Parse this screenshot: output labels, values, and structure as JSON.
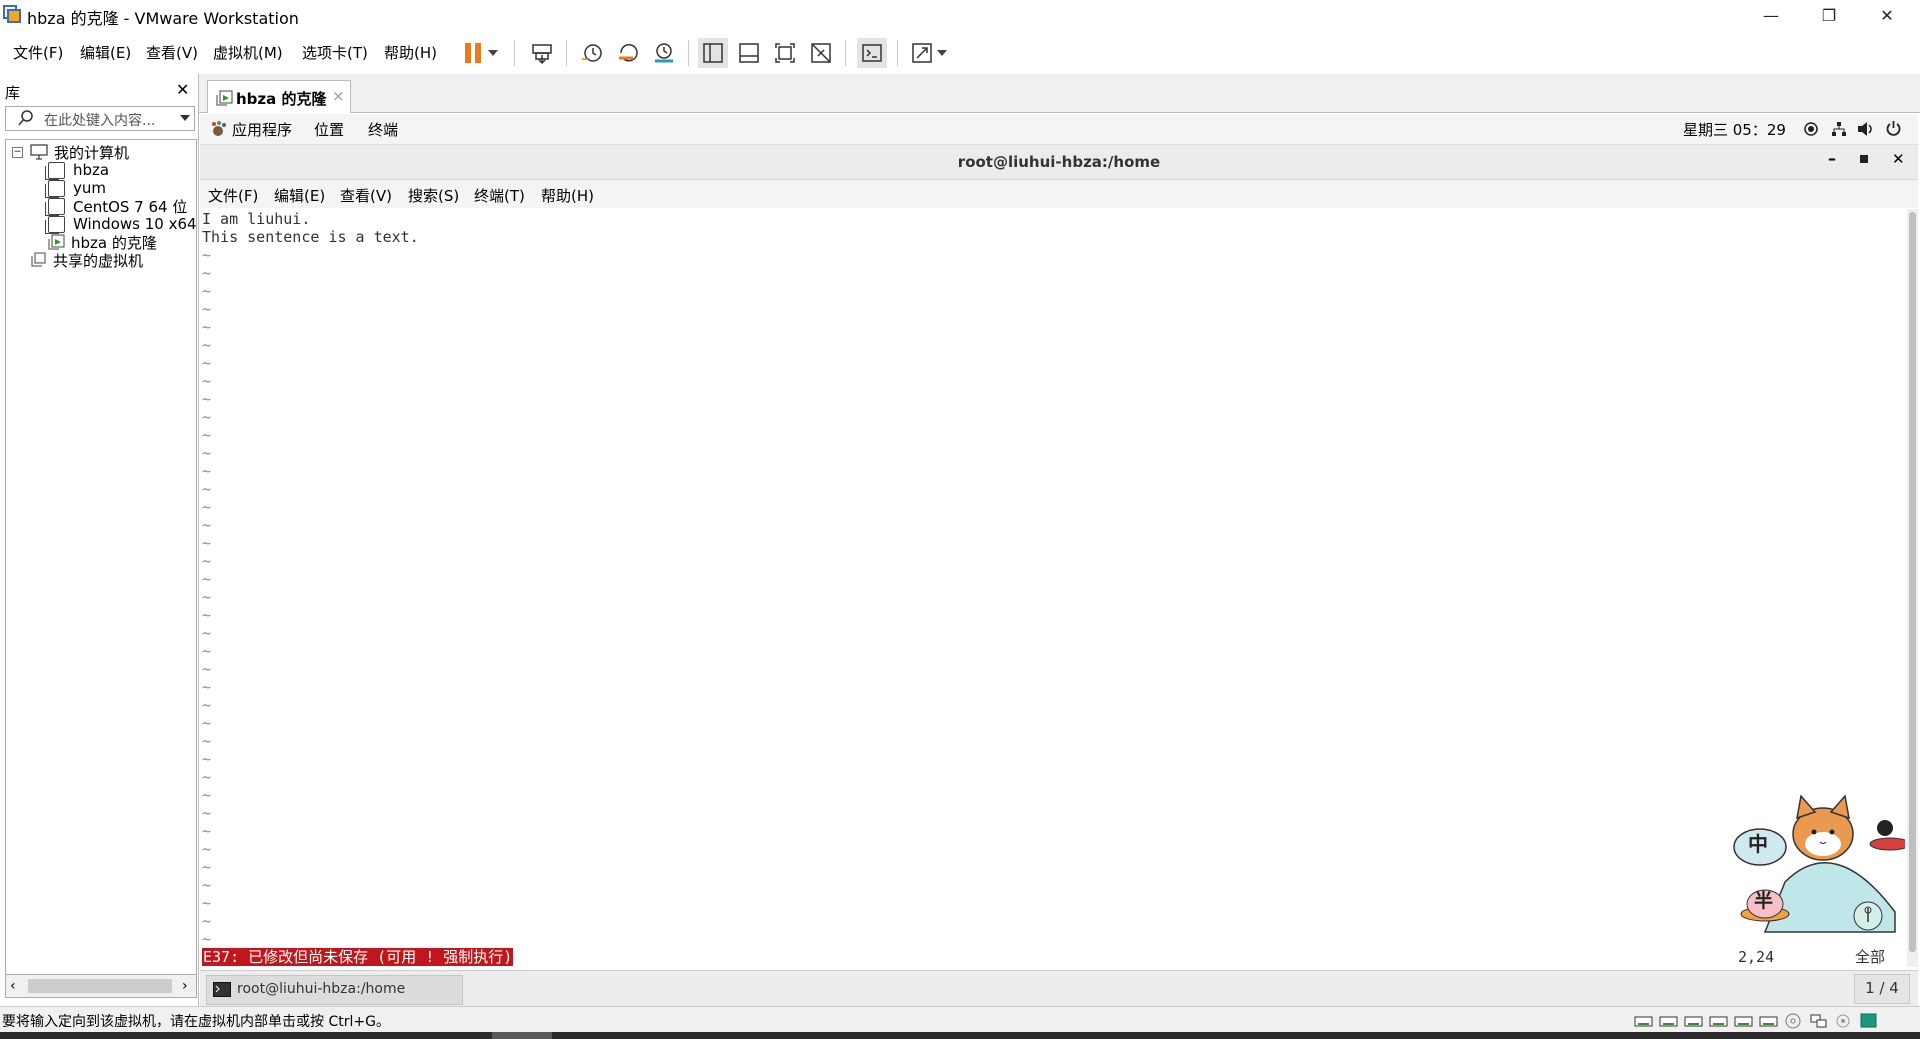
{
  "window": {
    "title": "hbza 的克隆 - VMware Workstation",
    "min_label": "—",
    "max_label": "❐",
    "close_label": "✕"
  },
  "menu": [
    "文件(F)",
    "编辑(E)",
    "查看(V)",
    "虚拟机(M)",
    "选项卡(T)",
    "帮助(H)"
  ],
  "toolbar_icons": [
    "pause-icon",
    "dropdown-arrow-icon",
    "send-ctrl-alt-del-icon",
    "snapshot-icon",
    "revert-snapshot-icon",
    "snapshot-manager-icon",
    "library-view-icon",
    "thumbnail-bar-icon",
    "full-screen-icon",
    "unity-icon",
    "console-view-icon",
    "stretch-icon",
    "dropdown-arrow-icon"
  ],
  "library": {
    "title": "库",
    "search_placeholder": "在此处键入内容...",
    "items": [
      {
        "label": "我的计算机",
        "icon": "computer-icon"
      },
      {
        "label": "hbza",
        "icon": "vm-icon"
      },
      {
        "label": "yum",
        "icon": "vm-icon"
      },
      {
        "label": "CentOS 7 64 位",
        "icon": "vm-icon"
      },
      {
        "label": "Windows 10 x64",
        "icon": "vm-icon"
      },
      {
        "label": "hbza 的克隆",
        "icon": "vm-running-icon"
      },
      {
        "label": "共享的虚拟机",
        "icon": "shared-vm-icon"
      }
    ]
  },
  "vm_tab": {
    "label": "hbza 的克隆",
    "close": "×"
  },
  "guest_topbar": {
    "apps": "应用程序",
    "places": "位置",
    "terminal": "终端",
    "clock": "星期三 05：29"
  },
  "terminal": {
    "title": "root@liuhui-hbza:/home",
    "menu": [
      "文件(F)",
      "编辑(E)",
      "查看(V)",
      "搜索(S)",
      "终端(T)",
      "帮助(H)"
    ],
    "lines": [
      "I am liuhui.",
      "This sentence is a text."
    ],
    "tilde": "~",
    "status_message": "E37: 已修改但尚未保存 (可用 ! 强制执行)",
    "cursor_pos": "2,24",
    "scroll_pos": "全部"
  },
  "guest_taskbar": {
    "item": "root@liuhui-hbza:/home",
    "workspace": "1 / 4"
  },
  "status": {
    "hint": "要将输入定向到该虚拟机，请在虚拟机内部单击或按 Ctrl+G。"
  },
  "ime_widget": {
    "mode_char": "中",
    "width_char": "半"
  },
  "colors": {
    "accent": "#e87b1c",
    "error_bg": "#c0161c"
  }
}
